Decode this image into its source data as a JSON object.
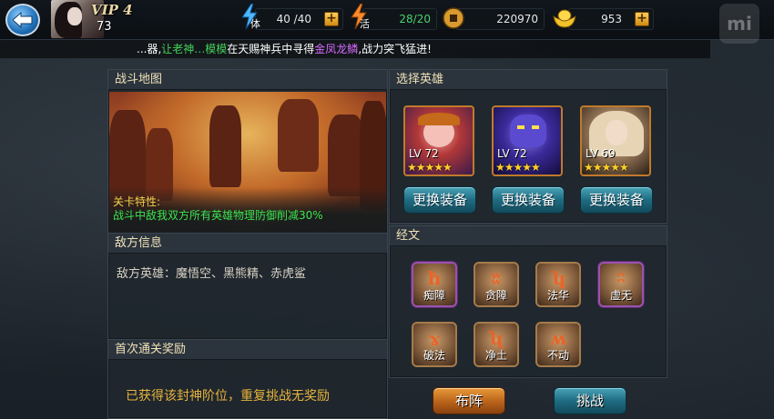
{
  "topbar": {
    "vip_label": "VIP 4",
    "player_level": "73",
    "stamina": {
      "label": "体",
      "value": "40 /40"
    },
    "vigor": {
      "label": "活",
      "value": "28/20"
    },
    "coins": {
      "value": "220970"
    },
    "ingots": {
      "value": "953"
    }
  },
  "marquee": {
    "part1": "...器,",
    "part2": "让老神…模模",
    "part3": "在天赐神兵中寻得",
    "part4": "金凤龙鳞",
    "part5": ",战力突飞猛进!"
  },
  "mi_label": "mi",
  "map_panel": {
    "title": "战斗地图",
    "feature_title": "关卡特性:",
    "feature_desc": "战斗中敌我双方所有英雄物理防御削减30%"
  },
  "enemy_panel": {
    "title": "敌方信息",
    "text": "敌方英雄：魔悟空、黑熊精、赤虎鲨"
  },
  "reward_panel": {
    "title": "首次通关奖励",
    "text": "已获得该封神阶位，重复挑战无奖励"
  },
  "hero_panel": {
    "title": "选择英雄",
    "heroes": [
      {
        "level": "LV 72",
        "stars": "★★★★★",
        "equip_label": "更换装备"
      },
      {
        "level": "LV 72",
        "stars": "★★★★★",
        "equip_label": "更换装备"
      },
      {
        "level": "LV 69",
        "stars": "★★★★★",
        "equip_label": "更换装备"
      }
    ]
  },
  "scripture_panel": {
    "title": "经文",
    "runes": [
      {
        "name": "痴障",
        "glyph": "ħ"
      },
      {
        "name": "贪障",
        "glyph": "ʬ"
      },
      {
        "name": "法华",
        "glyph": "ʮ"
      },
      {
        "name": "虚无",
        "glyph": "ʭ"
      },
      {
        "name": "破法",
        "glyph": "ɤ"
      },
      {
        "name": "净土",
        "glyph": "ʯ"
      },
      {
        "name": "不动",
        "glyph": "ʍ"
      }
    ]
  },
  "actions": {
    "formation_label": "布阵",
    "challenge_label": "挑战"
  }
}
